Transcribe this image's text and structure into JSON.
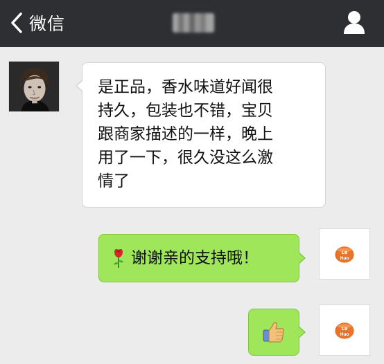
{
  "header": {
    "back_label": "微信",
    "title": "",
    "back_icon": "chevron-left-icon",
    "contact_icon": "person-icon"
  },
  "messages": [
    {
      "direction": "received",
      "text": "是正品，香水味道好闻很持久，包装也不错，宝贝跟商家描述的一样，晚上用了一下，很久没这么激情了",
      "lines": [
        "是正品，香水味道好闻很",
        "持久，包装也不错，宝贝",
        "跟商家描述的一样，晚上",
        "用了一下，很久没这么激",
        "情了"
      ]
    },
    {
      "direction": "sent",
      "emoji_icon": "rose-icon",
      "text": "谢谢亲的支持哦！"
    },
    {
      "direction": "sent",
      "emoji_icon": "thumbs-up-icon",
      "text": ""
    }
  ],
  "avatars": {
    "received": "user-avatar-photo",
    "sent_logo_text": [
      "Le",
      "Huo"
    ]
  },
  "colors": {
    "header_bg": "#2e2f33",
    "chat_bg": "#ececec",
    "received_bubble": "#ffffff",
    "sent_bubble": "#9fe65a",
    "logo_orange": "#e8742a"
  }
}
